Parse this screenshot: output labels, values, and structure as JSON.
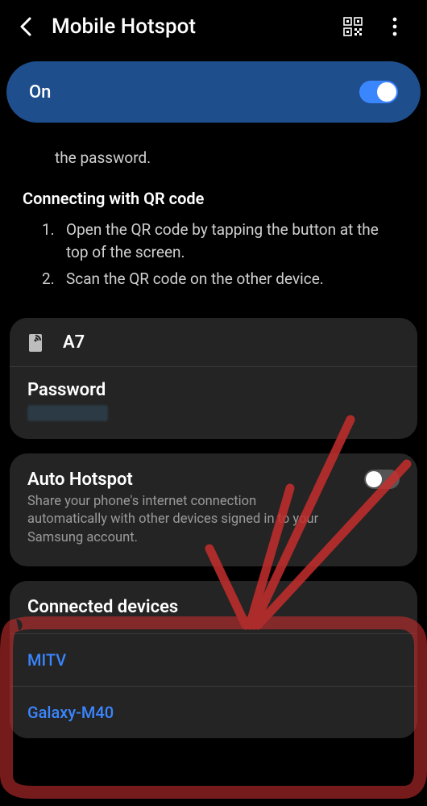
{
  "header": {
    "title": "Mobile Hotspot"
  },
  "main_toggle": {
    "label": "On",
    "state": "on"
  },
  "instructions": {
    "fragment": "the password.",
    "qr_title": "Connecting with QR code",
    "steps": {
      "s1_num": "1.",
      "s1_text": "Open the QR code by tapping the button at the top of the screen.",
      "s2_num": "2.",
      "s2_text": "Scan the QR code on the other device."
    }
  },
  "network": {
    "name": "A7",
    "password_label": "Password"
  },
  "auto_hotspot": {
    "title": "Auto Hotspot",
    "subtitle": "Share your phone's internet connection automatically with other devices signed in to your Samsung account.",
    "state": "off"
  },
  "connected": {
    "title": "Connected devices",
    "devices": {
      "d0": "MITV",
      "d1": "Galaxy-M40"
    }
  }
}
